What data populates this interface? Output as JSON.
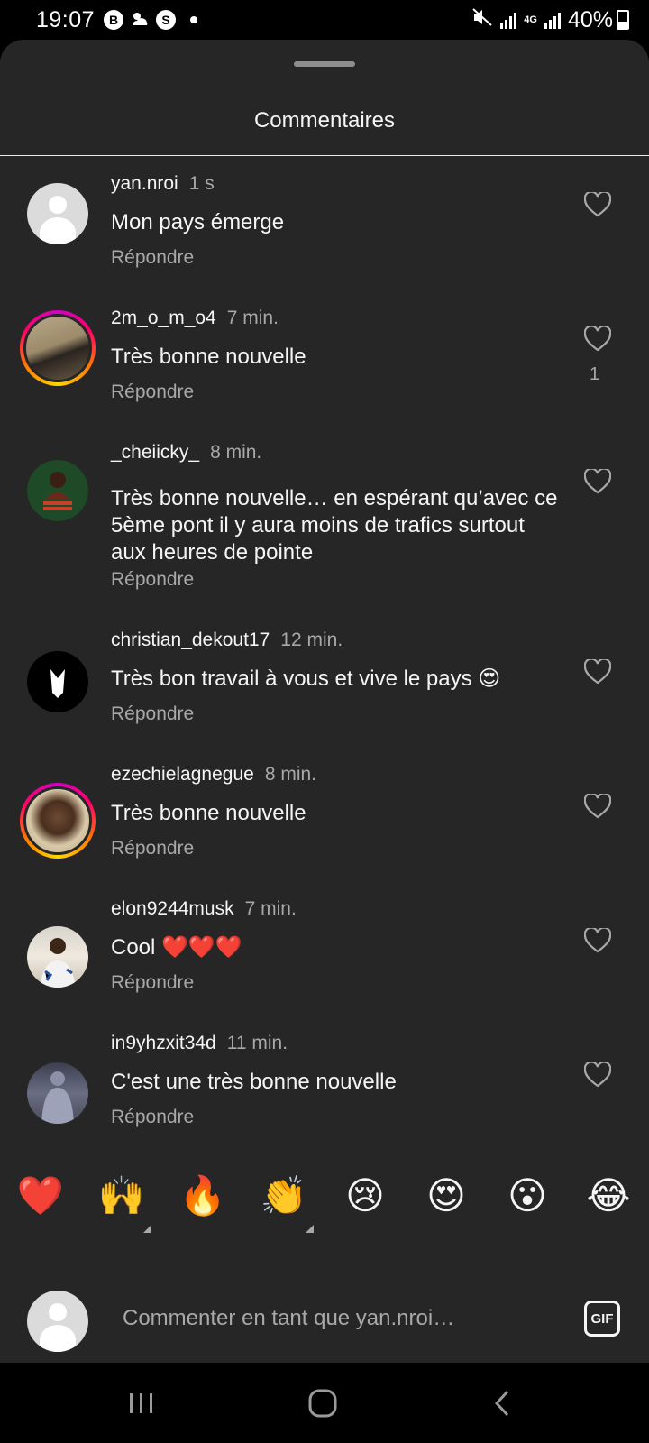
{
  "status_bar": {
    "time": "19:07",
    "icons": [
      "b-circle-icon",
      "cloud-sun-icon",
      "s-circle-icon",
      "dot-icon"
    ],
    "network": "4G",
    "battery": "40%",
    "battery_level": 0.4
  },
  "sheet": {
    "title": "Commentaires"
  },
  "comments": [
    {
      "user": "yan.nroi",
      "time": "1 s",
      "text": "Mon pays émerge",
      "reply": "Répondre",
      "likes": "",
      "avatar": "default"
    },
    {
      "user": "2m_o_m_o4",
      "time": "7 min.",
      "text": "Très bonne nouvelle",
      "reply": "Répondre",
      "likes": "1",
      "avatar": "story"
    },
    {
      "user": "_cheiicky_",
      "time": "8 min.",
      "text": "Très bonne nouvelle… en espérant qu’avec ce 5ème pont il y aura moins de trafics surtout aux heures de pointe",
      "reply": "Répondre",
      "likes": "",
      "avatar": "photo"
    },
    {
      "user": "christian_dekout17",
      "time": "12 min.",
      "text": "Très bon travail à vous et vive le pays 😍",
      "reply": "Répondre",
      "likes": "",
      "avatar": "photo"
    },
    {
      "user": "ezechielagnegue",
      "time": "8 min.",
      "text": "Très bonne nouvelle",
      "reply": "Répondre",
      "likes": "",
      "avatar": "story"
    },
    {
      "user": "elon9244musk",
      "time": "7 min.",
      "text": "Cool ❤️❤️❤️",
      "reply": "Répondre",
      "likes": "",
      "avatar": "photo"
    },
    {
      "user": "in9yhzxit34d",
      "time": "11 min.",
      "text": "C'est une très bonne nouvelle",
      "reply": "Répondre",
      "likes": "",
      "avatar": "photo"
    }
  ],
  "emoji_bar": [
    "❤️",
    "🙌",
    "🔥",
    "👏",
    "😢",
    "😍",
    "😮",
    "😂"
  ],
  "composer": {
    "placeholder": "Commenter en tant que yan.nroi…",
    "gif_label": "GIF"
  },
  "nav_bar": {
    "buttons": [
      "recent-apps-icon",
      "home-icon",
      "back-icon"
    ]
  },
  "colors": {
    "sheet_bg": "#262626",
    "secondary_text": "#a8a8a8",
    "primary_text": "#f5f5f5"
  }
}
